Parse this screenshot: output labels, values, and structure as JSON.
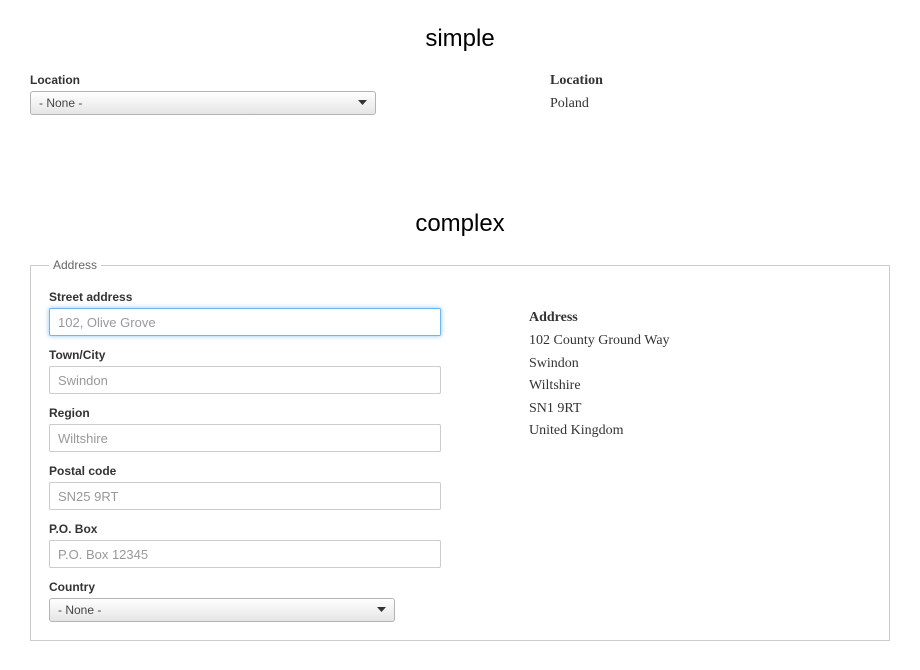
{
  "sections": {
    "simple_title": "simple",
    "complex_title": "complex"
  },
  "simple": {
    "form": {
      "location_label": "Location",
      "location_value": "- None -"
    },
    "display": {
      "location_label": "Location",
      "location_value": "Poland"
    }
  },
  "complex": {
    "legend": "Address",
    "form": {
      "street_label": "Street address",
      "street_placeholder": "102, Olive Grove",
      "town_label": "Town/City",
      "town_placeholder": "Swindon",
      "region_label": "Region",
      "region_placeholder": "Wiltshire",
      "postal_label": "Postal code",
      "postal_placeholder": "SN25 9RT",
      "pobox_label": "P.O. Box",
      "pobox_placeholder": "P.O. Box 12345",
      "country_label": "Country",
      "country_value": "- None -"
    },
    "display": {
      "heading": "Address",
      "lines": [
        "102 County Ground Way",
        "Swindon",
        "Wiltshire",
        "SN1 9RT",
        "United Kingdom"
      ]
    }
  }
}
